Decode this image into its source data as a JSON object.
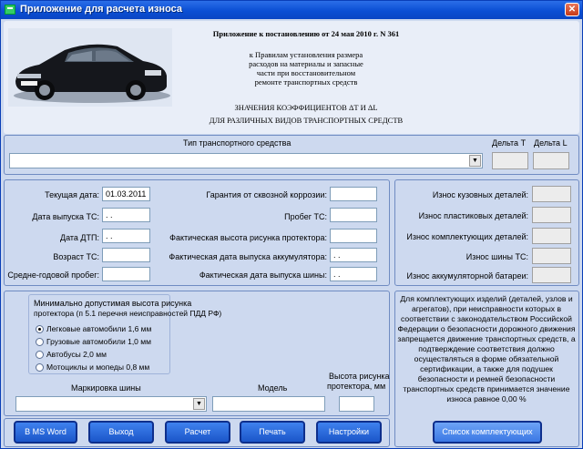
{
  "window": {
    "title": "Приложение для расчета износа"
  },
  "header": {
    "line1": "Приложение к постановлению от 24 мая 2010 г. N 361",
    "rules": [
      "к Правилам установления размера",
      "расходов на материалы и запасные",
      "части при восстановительном",
      "ремонте транспортных средств"
    ],
    "coef_line1": "ЗНАЧЕНИЯ КОЭФФИЦИЕНТОВ ΔT И ΔL",
    "coef_line2": "ДЛЯ РАЗЛИЧНЫХ ВИДОВ ТРАНСПОРТНЫХ СРЕДСТВ",
    "car_image": "car-photo"
  },
  "vehicle": {
    "type_label": "Тип транспортного средства",
    "type_value": "",
    "delta_t_label": "Дельта T",
    "delta_l_label": "Дельта L",
    "delta_t": "",
    "delta_l": ""
  },
  "dates": {
    "current_label": "Текущая дата:",
    "current_value": "01.03.2011",
    "release_label": "Дата выпуска ТС:",
    "release_value": " .  .",
    "accident_label": "Дата ДТП:",
    "accident_value": " .  .",
    "age_label": "Возраст ТС:",
    "age_value": "",
    "mileage_label": "Средне-годовой пробег:",
    "mileage_value": ""
  },
  "params": {
    "corrosion_label": "Гарантия от сквозной коррозии:",
    "corrosion_value": "",
    "run_label": "Пробег ТС:",
    "run_value": "",
    "tread_label": "Фактическая высота рисунка протектора:",
    "tread_value": "",
    "battery_label": "Фактическая дата выпуска аккумулятора:",
    "battery_value": " .  .",
    "tires_label": "Фактическая дата выпуска шины:",
    "tires_value": " .  ."
  },
  "wear": {
    "body_label": "Износ кузовных деталей:",
    "plastic_label": "Износ  пластиковых деталей:",
    "parts_label": "Износ комплектующих деталей:",
    "tires_label": "Износ шины ТС:",
    "battery_label": "Износ аккумуляторной батареи:"
  },
  "tread": {
    "heading1": "Минимально допустимая высота рисунка",
    "heading2": "протектора (п 5.1 перечня неисправностей ПДД РФ)",
    "options": [
      "Легковые автомобили 1,6 мм",
      "Грузовые автомобили 1,0 мм",
      "Автобусы 2,0 мм",
      "Мотоциклы и мопеды 0,8 мм"
    ],
    "selected": 0,
    "marking_label": "Маркировка шины",
    "model_label": "Модель",
    "height_label1": "Высота рисунка",
    "height_label2": "протектора, мм"
  },
  "note": "Для комплектующих изделий (деталей, узлов и агрегатов), при неисправности которых в соответствии с законодательством Российской Федерации о безопасности дорожного движения запрещается движение транспортных средств, а подтверждение соответствия должно осуществляться в форме обязательной сертификации, а также для подушек безопасности и ремней безопасности транспортных средств принимается значение износа равное 0,00 %",
  "buttons": {
    "word": "В MS Word",
    "exit": "Выход",
    "calc": "Расчет",
    "print": "Печать",
    "settings": "Настройки",
    "parts_list": "Список комплектующих"
  }
}
